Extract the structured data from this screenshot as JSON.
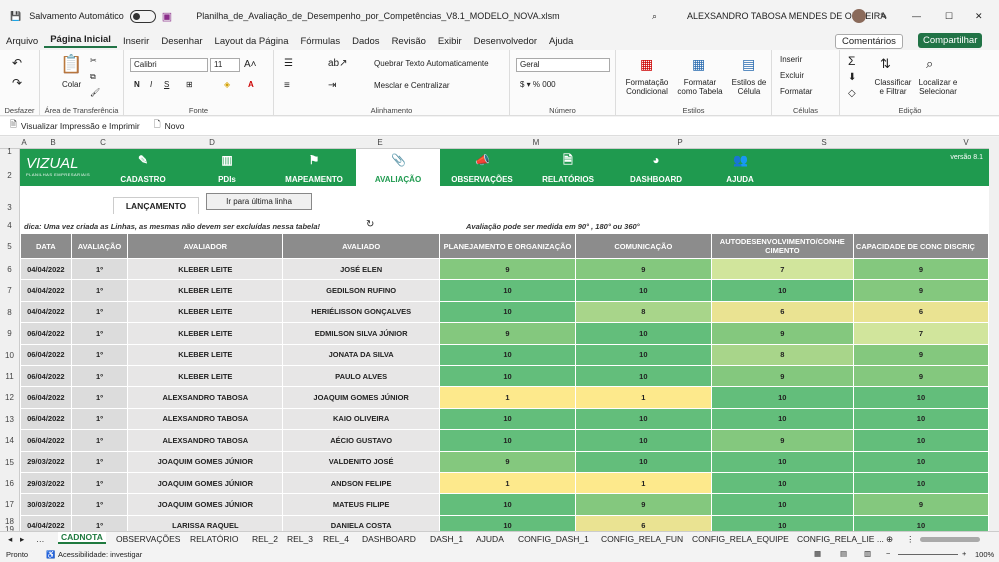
{
  "titlebar": {
    "autosave": "Salvamento Automático",
    "filename": "Planilha_de_Avaliação_de_Desempenho_por_Competências_V8.1_MODELO_NOVA.xlsm",
    "user": "ALEXSANDRO TABOSA MENDES DE OLIVEIRA"
  },
  "menu": [
    "Arquivo",
    "Página Inicial",
    "Inserir",
    "Desenhar",
    "Layout da Página",
    "Fórmulas",
    "Dados",
    "Revisão",
    "Exibir",
    "Desenvolvedor",
    "Ajuda"
  ],
  "menu_right": {
    "comments": "Comentários",
    "share": "Compartilhar"
  },
  "ribbon": {
    "desfazer": "Desfazer",
    "transfer": "Área de Transferência",
    "paste": "Colar",
    "font_name": "Calibri",
    "font_size": "11",
    "fonte": "Fonte",
    "wrap": "Quebrar Texto Automaticamente",
    "merge": "Mesclar e Centralizar",
    "alinhamento": "Alinhamento",
    "num_format": "Geral",
    "numero": "Número",
    "cond": "Formatação Condicional",
    "table": "Formatar como Tabela",
    "styles": "Estilos de Célula",
    "estilos": "Estilos",
    "insert": "Inserir",
    "delete": "Excluir",
    "format": "Formatar",
    "celulas": "Células",
    "sort": "Classificar e Filtrar",
    "find": "Localizar e Selecionar",
    "edicao": "Edição"
  },
  "qat": {
    "print": "Visualizar Impressão e Imprimir",
    "new": "Novo"
  },
  "columns": [
    "A",
    "B",
    "C",
    "D",
    "E",
    "M",
    "P",
    "S",
    "V"
  ],
  "rows": [
    "1",
    "2",
    "3",
    "4",
    "5",
    "6",
    "7",
    "8",
    "9",
    "10",
    "11",
    "12",
    "13",
    "14",
    "15",
    "16",
    "17",
    "18",
    "19"
  ],
  "nav": {
    "logo": "VIZUAL",
    "logo_sub": "PLANILHAS EMPRESARIAIS",
    "version": "versão 8.1",
    "items": [
      "CADASTRO",
      "PDIs",
      "MAPEAMENTO",
      "AVALIAÇÃO",
      "OBSERVAÇÕES",
      "RELATÓRIOS",
      "DASHBOARD",
      "AJUDA"
    ]
  },
  "lanc": "LANÇAMENTO",
  "btn_last": "Ir para última linha",
  "hint_left": "dica: Uma vez criada as Linhas, as mesmas não devem ser excluídas nessa tabela!",
  "hint_right": "Avaliação pode ser medida em 90° , 180° ou 360°",
  "headers": [
    "DATA",
    "AVALIAÇÃO",
    "AVALIADOR",
    "AVALIADO",
    "PLANEJAMENTO E ORGANIZAÇÃO",
    "COMUNICAÇÃO",
    "AUTODESENVOLVIMENTO/CONHECIMENTO",
    "CAPACIDADE DE CONCENTRAÇÃO/DISCRIÇÃO"
  ],
  "header_visible": [
    "DATA",
    "AVALIAÇÃO",
    "AVALIADOR",
    "AVALIADO",
    "PLANEJAMENTO E ORGANIZAÇÃO",
    "COMUNICAÇÃO",
    "AUTODESENVOLVIMENTO/CONHE CIMENTO",
    "CAPACIDADE DE CONC DISCRIÇ"
  ],
  "data_rows": [
    [
      "04/04/2022",
      "1º",
      "KLEBER LEITE",
      "JOSÉ ELEN",
      "9",
      "9",
      "7",
      "9"
    ],
    [
      "04/04/2022",
      "1º",
      "KLEBER LEITE",
      "GEDILSON RUFINO",
      "10",
      "10",
      "10",
      "9"
    ],
    [
      "04/04/2022",
      "1º",
      "KLEBER LEITE",
      "HERIÉLISSON GONÇALVES",
      "10",
      "8",
      "6",
      "6"
    ],
    [
      "06/04/2022",
      "1º",
      "KLEBER LEITE",
      "EDMILSON SILVA JÚNIOR",
      "9",
      "10",
      "9",
      "7"
    ],
    [
      "06/04/2022",
      "1º",
      "KLEBER LEITE",
      "JONATA DA SILVA",
      "10",
      "10",
      "8",
      "9"
    ],
    [
      "06/04/2022",
      "1º",
      "KLEBER LEITE",
      "PAULO ALVES",
      "10",
      "10",
      "9",
      "9"
    ],
    [
      "06/04/2022",
      "1º",
      "ALEXSANDRO TABOSA",
      "JOAQUIM GOMES JÚNIOR",
      "1",
      "1",
      "10",
      "10"
    ],
    [
      "06/04/2022",
      "1º",
      "ALEXSANDRO TABOSA",
      "KAIO OLIVEIRA",
      "10",
      "10",
      "10",
      "10"
    ],
    [
      "06/04/2022",
      "1º",
      "ALEXSANDRO TABOSA",
      "AÉCIO GUSTAVO",
      "10",
      "10",
      "9",
      "10"
    ],
    [
      "29/03/2022",
      "1º",
      "JOAQUIM GOMES JÚNIOR",
      "VALDENITO JOSÉ",
      "9",
      "10",
      "10",
      "10"
    ],
    [
      "29/03/2022",
      "1º",
      "JOAQUIM GOMES JÚNIOR",
      "ANDSON FELIPE",
      "1",
      "1",
      "10",
      "10"
    ],
    [
      "30/03/2022",
      "1º",
      "JOAQUIM GOMES JÚNIOR",
      "MATEUS FILIPE",
      "10",
      "9",
      "10",
      "9"
    ],
    [
      "04/04/2022",
      "1º",
      "LARISSA RAQUEL",
      "DANIELA COSTA",
      "10",
      "6",
      "10",
      "10"
    ]
  ],
  "sheets": [
    "CADNOTA",
    "OBSERVAÇÕES",
    "RELATÓRIO",
    "REL_2",
    "REL_3",
    "REL_4",
    "DASHBOARD",
    "DASH_1",
    "AJUDA",
    "CONFIG_DASH_1",
    "CONFIG_RELA_FUN",
    "CONFIG_RELA_EQUIPE",
    "CONFIG_RELA_LIE ..."
  ],
  "status": {
    "ready": "Pronto",
    "access": "Acessibilidade: investigar",
    "zoom": "100%"
  },
  "colors": {
    "green": "#1f9a4f",
    "high": "#63be7b",
    "mid": "#c9e3a0",
    "low": "#fde98c"
  }
}
